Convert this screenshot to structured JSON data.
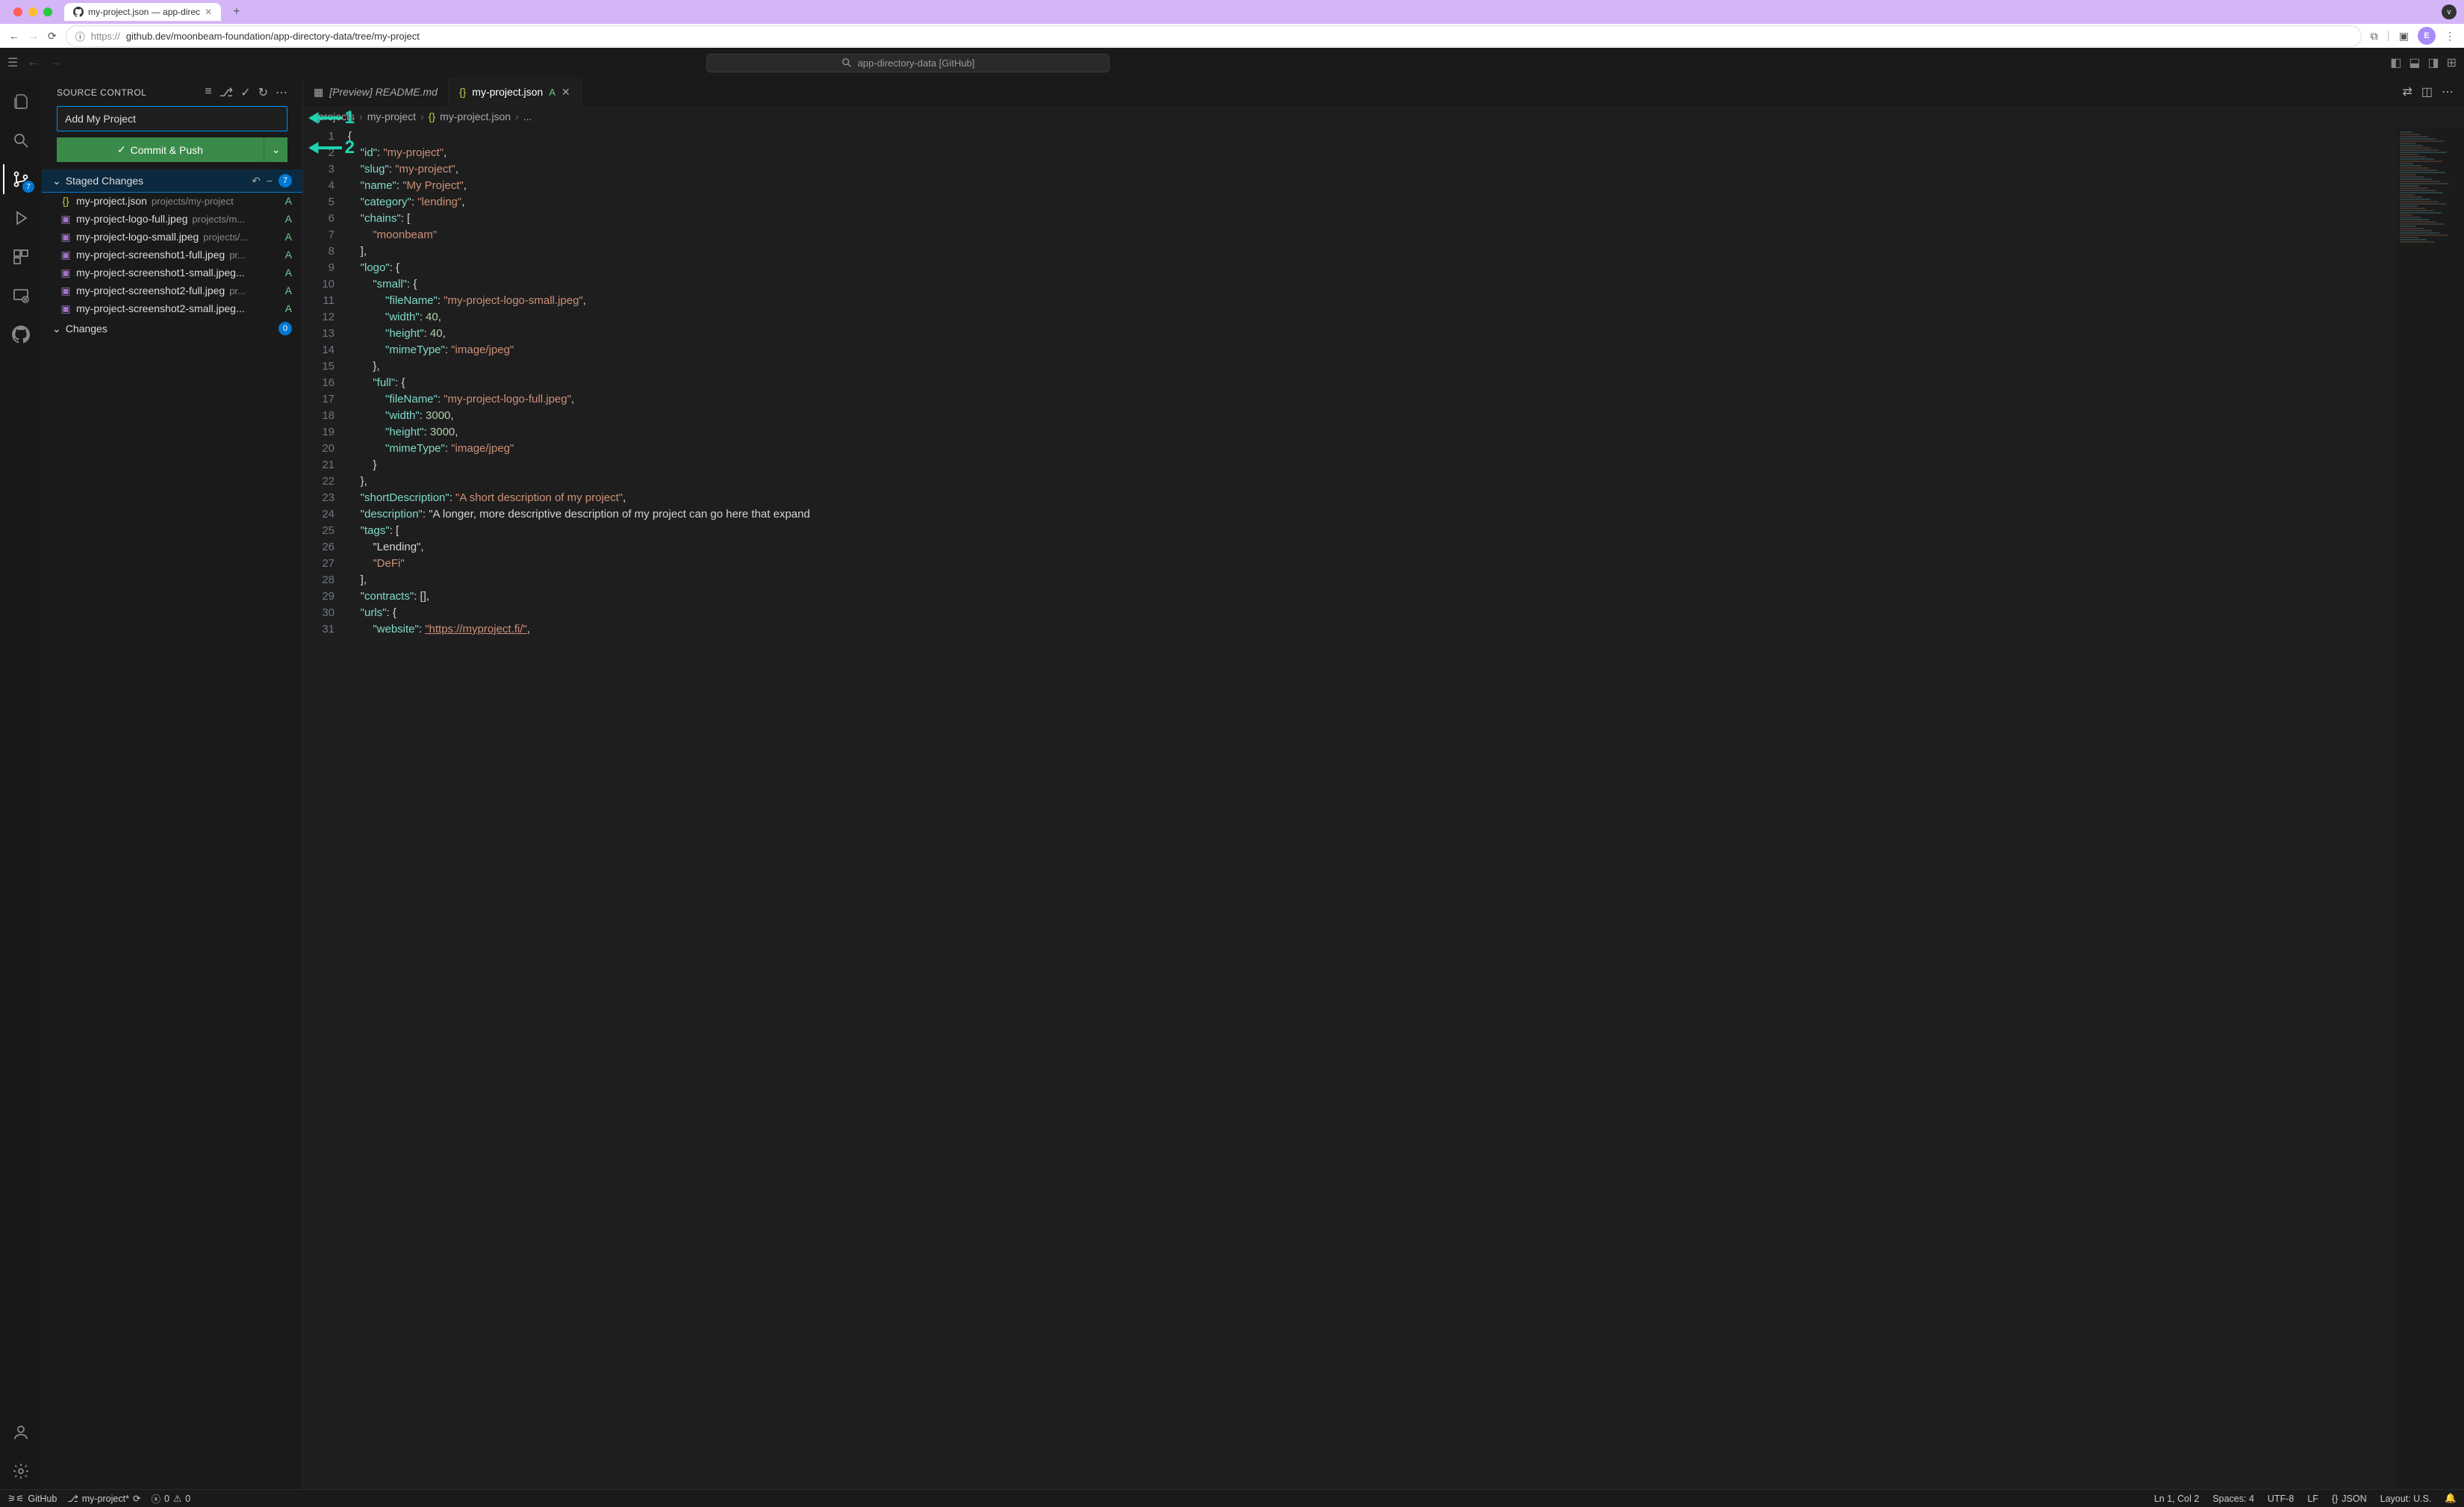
{
  "browser": {
    "tab_title": "my-project.json — app-direc",
    "url_scheme": "https://",
    "url_rest": "github.dev/moonbeam-foundation/app-directory-data/tree/my-project",
    "avatar_letter": "E",
    "extend_icon": "v"
  },
  "titlebar": {
    "search_text": "app-directory-data [GitHub]"
  },
  "activity": {
    "scm_badge": "7"
  },
  "scm": {
    "title": "Source Control",
    "commit_message": "Add My Project",
    "commit_button": "Commit & Push",
    "staged_label": "Staged Changes",
    "staged_count": "7",
    "changes_label": "Changes",
    "changes_count": "0",
    "files": [
      {
        "name": "my-project.json",
        "dir": "projects/my-project",
        "status": "A",
        "type": "json"
      },
      {
        "name": "my-project-logo-full.jpeg",
        "dir": "projects/m...",
        "status": "A",
        "type": "img"
      },
      {
        "name": "my-project-logo-small.jpeg",
        "dir": "projects/...",
        "status": "A",
        "type": "img"
      },
      {
        "name": "my-project-screenshot1-full.jpeg",
        "dir": "pr...",
        "status": "A",
        "type": "img"
      },
      {
        "name": "my-project-screenshot1-small.jpeg...",
        "dir": "",
        "status": "A",
        "type": "img"
      },
      {
        "name": "my-project-screenshot2-full.jpeg",
        "dir": "pr...",
        "status": "A",
        "type": "img"
      },
      {
        "name": "my-project-screenshot2-small.jpeg...",
        "dir": "",
        "status": "A",
        "type": "img"
      }
    ]
  },
  "tabs": {
    "preview": "[Preview] README.md",
    "active": "my-project.json",
    "active_status": "A"
  },
  "breadcrumb": {
    "p1": "projects",
    "p2": "my-project",
    "p3": "my-project.json",
    "p4": "..."
  },
  "code_lines": [
    {
      "n": "1",
      "t": "{"
    },
    {
      "n": "2",
      "t": "    \"id\": \"my-project\","
    },
    {
      "n": "3",
      "t": "    \"slug\": \"my-project\","
    },
    {
      "n": "4",
      "t": "    \"name\": \"My Project\","
    },
    {
      "n": "5",
      "t": "    \"category\": \"lending\","
    },
    {
      "n": "6",
      "t": "    \"chains\": ["
    },
    {
      "n": "7",
      "t": "        \"moonbeam\""
    },
    {
      "n": "8",
      "t": "    ],"
    },
    {
      "n": "9",
      "t": "    \"logo\": {"
    },
    {
      "n": "10",
      "t": "        \"small\": {"
    },
    {
      "n": "11",
      "t": "            \"fileName\": \"my-project-logo-small.jpeg\","
    },
    {
      "n": "12",
      "t": "            \"width\": 40,"
    },
    {
      "n": "13",
      "t": "            \"height\": 40,"
    },
    {
      "n": "14",
      "t": "            \"mimeType\": \"image/jpeg\""
    },
    {
      "n": "15",
      "t": "        },"
    },
    {
      "n": "16",
      "t": "        \"full\": {"
    },
    {
      "n": "17",
      "t": "            \"fileName\": \"my-project-logo-full.jpeg\","
    },
    {
      "n": "18",
      "t": "            \"width\": 3000,"
    },
    {
      "n": "19",
      "t": "            \"height\": 3000,"
    },
    {
      "n": "20",
      "t": "            \"mimeType\": \"image/jpeg\""
    },
    {
      "n": "21",
      "t": "        }"
    },
    {
      "n": "22",
      "t": "    },"
    },
    {
      "n": "23",
      "t": "    \"shortDescription\": \"A short description of my project\","
    },
    {
      "n": "24",
      "t": "    \"description\": \"A longer, more descriptive description of my project can go here that expand"
    },
    {
      "n": "25",
      "t": "    \"tags\": ["
    },
    {
      "n": "26",
      "t": "        \"Lending\","
    },
    {
      "n": "27",
      "t": "        \"DeFi\""
    },
    {
      "n": "28",
      "t": "    ],"
    },
    {
      "n": "29",
      "t": "    \"contracts\": [],"
    },
    {
      "n": "30",
      "t": "    \"urls\": {"
    },
    {
      "n": "31",
      "t": "        \"website\": \"https://myproject.fi/\","
    }
  ],
  "status": {
    "remote_icon": "⎘",
    "remote": "GitHub",
    "branch": "my-project*",
    "errors": "0",
    "warnings": "0",
    "cursor": "Ln 1, Col 2",
    "spaces": "Spaces: 4",
    "encoding": "UTF-8",
    "eol": "LF",
    "lang_icon": "{}",
    "lang": "JSON",
    "layout": "Layout: U.S."
  },
  "annotations": {
    "a1": "1",
    "a2": "2"
  }
}
